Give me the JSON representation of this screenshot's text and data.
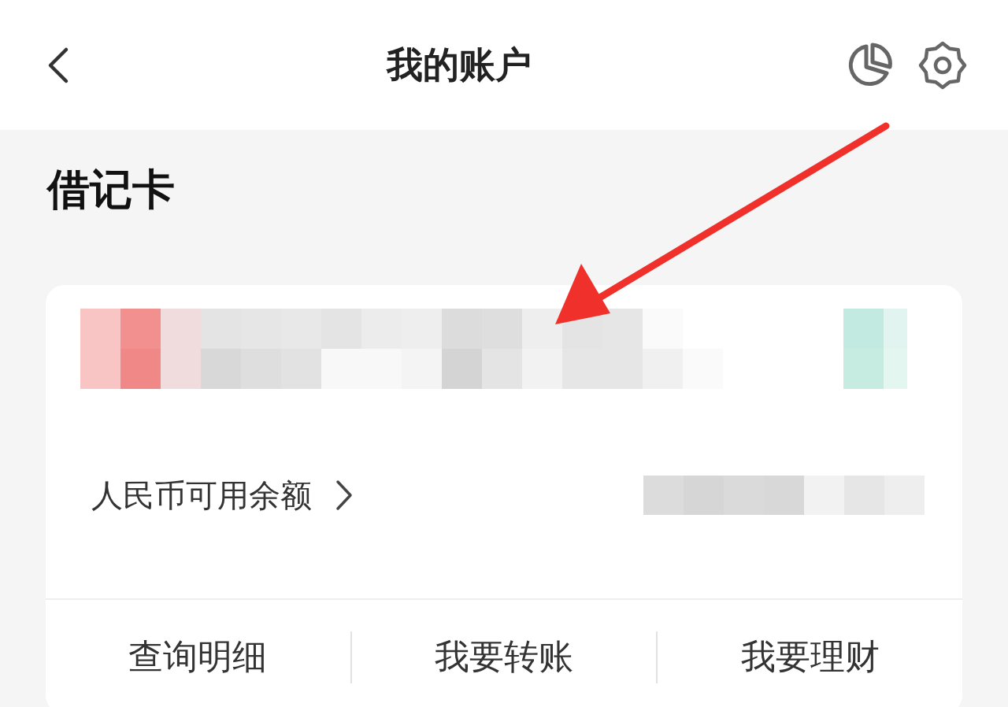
{
  "header": {
    "title": "我的账户"
  },
  "section": {
    "title": "借记卡"
  },
  "card": {
    "balance_label": "人民币可用余额",
    "actions": [
      {
        "label": "查询明细"
      },
      {
        "label": "我要转账"
      },
      {
        "label": "我要理财"
      }
    ]
  }
}
